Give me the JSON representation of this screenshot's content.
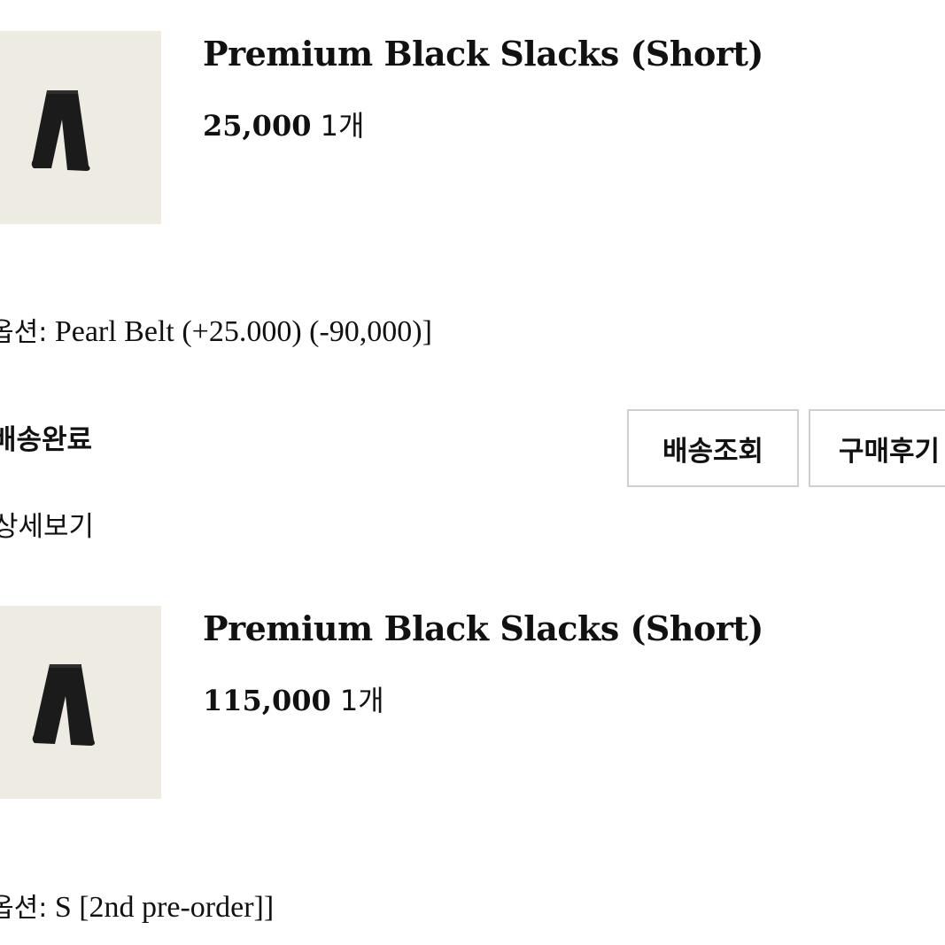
{
  "orders": [
    {
      "product_name": "Premium Black Slacks (Short)",
      "price": "25,000",
      "quantity": "1개",
      "option_label": "옵션:",
      "option_value": "Pearl Belt (+25.000) (-90,000)]",
      "thumbnail_icon": "black-slacks-image"
    },
    {
      "product_name": "Premium Black Slacks (Short)",
      "price": "115,000",
      "quantity": "1개",
      "option_label": "옵션:",
      "option_value": "S [2nd pre-order]]",
      "thumbnail_icon": "black-slacks-image"
    }
  ],
  "delivery": {
    "status": "배송완료",
    "track_button": "배송조회",
    "review_button": "구매후기",
    "detail_link": "상세보기"
  },
  "colors": {
    "thumbnail_bg": "#eeebe3",
    "button_border": "#cfcfcf",
    "text": "#111111"
  }
}
